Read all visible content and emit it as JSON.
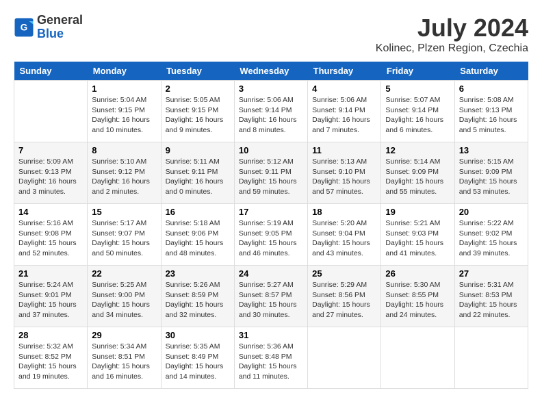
{
  "header": {
    "logo": {
      "general": "General",
      "blue": "Blue"
    },
    "title": "July 2024",
    "subtitle": "Kolinec, Plzen Region, Czechia"
  },
  "calendar": {
    "days_of_week": [
      "Sunday",
      "Monday",
      "Tuesday",
      "Wednesday",
      "Thursday",
      "Friday",
      "Saturday"
    ],
    "weeks": [
      [
        {
          "day": "",
          "empty": true
        },
        {
          "day": "1",
          "sunrise": "Sunrise: 5:04 AM",
          "sunset": "Sunset: 9:15 PM",
          "daylight": "Daylight: 16 hours and 10 minutes."
        },
        {
          "day": "2",
          "sunrise": "Sunrise: 5:05 AM",
          "sunset": "Sunset: 9:15 PM",
          "daylight": "Daylight: 16 hours and 9 minutes."
        },
        {
          "day": "3",
          "sunrise": "Sunrise: 5:06 AM",
          "sunset": "Sunset: 9:14 PM",
          "daylight": "Daylight: 16 hours and 8 minutes."
        },
        {
          "day": "4",
          "sunrise": "Sunrise: 5:06 AM",
          "sunset": "Sunset: 9:14 PM",
          "daylight": "Daylight: 16 hours and 7 minutes."
        },
        {
          "day": "5",
          "sunrise": "Sunrise: 5:07 AM",
          "sunset": "Sunset: 9:14 PM",
          "daylight": "Daylight: 16 hours and 6 minutes."
        },
        {
          "day": "6",
          "sunrise": "Sunrise: 5:08 AM",
          "sunset": "Sunset: 9:13 PM",
          "daylight": "Daylight: 16 hours and 5 minutes."
        }
      ],
      [
        {
          "day": "7",
          "sunrise": "Sunrise: 5:09 AM",
          "sunset": "Sunset: 9:13 PM",
          "daylight": "Daylight: 16 hours and 3 minutes."
        },
        {
          "day": "8",
          "sunrise": "Sunrise: 5:10 AM",
          "sunset": "Sunset: 9:12 PM",
          "daylight": "Daylight: 16 hours and 2 minutes."
        },
        {
          "day": "9",
          "sunrise": "Sunrise: 5:11 AM",
          "sunset": "Sunset: 9:11 PM",
          "daylight": "Daylight: 16 hours and 0 minutes."
        },
        {
          "day": "10",
          "sunrise": "Sunrise: 5:12 AM",
          "sunset": "Sunset: 9:11 PM",
          "daylight": "Daylight: 15 hours and 59 minutes."
        },
        {
          "day": "11",
          "sunrise": "Sunrise: 5:13 AM",
          "sunset": "Sunset: 9:10 PM",
          "daylight": "Daylight: 15 hours and 57 minutes."
        },
        {
          "day": "12",
          "sunrise": "Sunrise: 5:14 AM",
          "sunset": "Sunset: 9:09 PM",
          "daylight": "Daylight: 15 hours and 55 minutes."
        },
        {
          "day": "13",
          "sunrise": "Sunrise: 5:15 AM",
          "sunset": "Sunset: 9:09 PM",
          "daylight": "Daylight: 15 hours and 53 minutes."
        }
      ],
      [
        {
          "day": "14",
          "sunrise": "Sunrise: 5:16 AM",
          "sunset": "Sunset: 9:08 PM",
          "daylight": "Daylight: 15 hours and 52 minutes."
        },
        {
          "day": "15",
          "sunrise": "Sunrise: 5:17 AM",
          "sunset": "Sunset: 9:07 PM",
          "daylight": "Daylight: 15 hours and 50 minutes."
        },
        {
          "day": "16",
          "sunrise": "Sunrise: 5:18 AM",
          "sunset": "Sunset: 9:06 PM",
          "daylight": "Daylight: 15 hours and 48 minutes."
        },
        {
          "day": "17",
          "sunrise": "Sunrise: 5:19 AM",
          "sunset": "Sunset: 9:05 PM",
          "daylight": "Daylight: 15 hours and 46 minutes."
        },
        {
          "day": "18",
          "sunrise": "Sunrise: 5:20 AM",
          "sunset": "Sunset: 9:04 PM",
          "daylight": "Daylight: 15 hours and 43 minutes."
        },
        {
          "day": "19",
          "sunrise": "Sunrise: 5:21 AM",
          "sunset": "Sunset: 9:03 PM",
          "daylight": "Daylight: 15 hours and 41 minutes."
        },
        {
          "day": "20",
          "sunrise": "Sunrise: 5:22 AM",
          "sunset": "Sunset: 9:02 PM",
          "daylight": "Daylight: 15 hours and 39 minutes."
        }
      ],
      [
        {
          "day": "21",
          "sunrise": "Sunrise: 5:24 AM",
          "sunset": "Sunset: 9:01 PM",
          "daylight": "Daylight: 15 hours and 37 minutes."
        },
        {
          "day": "22",
          "sunrise": "Sunrise: 5:25 AM",
          "sunset": "Sunset: 9:00 PM",
          "daylight": "Daylight: 15 hours and 34 minutes."
        },
        {
          "day": "23",
          "sunrise": "Sunrise: 5:26 AM",
          "sunset": "Sunset: 8:59 PM",
          "daylight": "Daylight: 15 hours and 32 minutes."
        },
        {
          "day": "24",
          "sunrise": "Sunrise: 5:27 AM",
          "sunset": "Sunset: 8:57 PM",
          "daylight": "Daylight: 15 hours and 30 minutes."
        },
        {
          "day": "25",
          "sunrise": "Sunrise: 5:29 AM",
          "sunset": "Sunset: 8:56 PM",
          "daylight": "Daylight: 15 hours and 27 minutes."
        },
        {
          "day": "26",
          "sunrise": "Sunrise: 5:30 AM",
          "sunset": "Sunset: 8:55 PM",
          "daylight": "Daylight: 15 hours and 24 minutes."
        },
        {
          "day": "27",
          "sunrise": "Sunrise: 5:31 AM",
          "sunset": "Sunset: 8:53 PM",
          "daylight": "Daylight: 15 hours and 22 minutes."
        }
      ],
      [
        {
          "day": "28",
          "sunrise": "Sunrise: 5:32 AM",
          "sunset": "Sunset: 8:52 PM",
          "daylight": "Daylight: 15 hours and 19 minutes."
        },
        {
          "day": "29",
          "sunrise": "Sunrise: 5:34 AM",
          "sunset": "Sunset: 8:51 PM",
          "daylight": "Daylight: 15 hours and 16 minutes."
        },
        {
          "day": "30",
          "sunrise": "Sunrise: 5:35 AM",
          "sunset": "Sunset: 8:49 PM",
          "daylight": "Daylight: 15 hours and 14 minutes."
        },
        {
          "day": "31",
          "sunrise": "Sunrise: 5:36 AM",
          "sunset": "Sunset: 8:48 PM",
          "daylight": "Daylight: 15 hours and 11 minutes."
        },
        {
          "day": "",
          "empty": true
        },
        {
          "day": "",
          "empty": true
        },
        {
          "day": "",
          "empty": true
        }
      ]
    ]
  }
}
